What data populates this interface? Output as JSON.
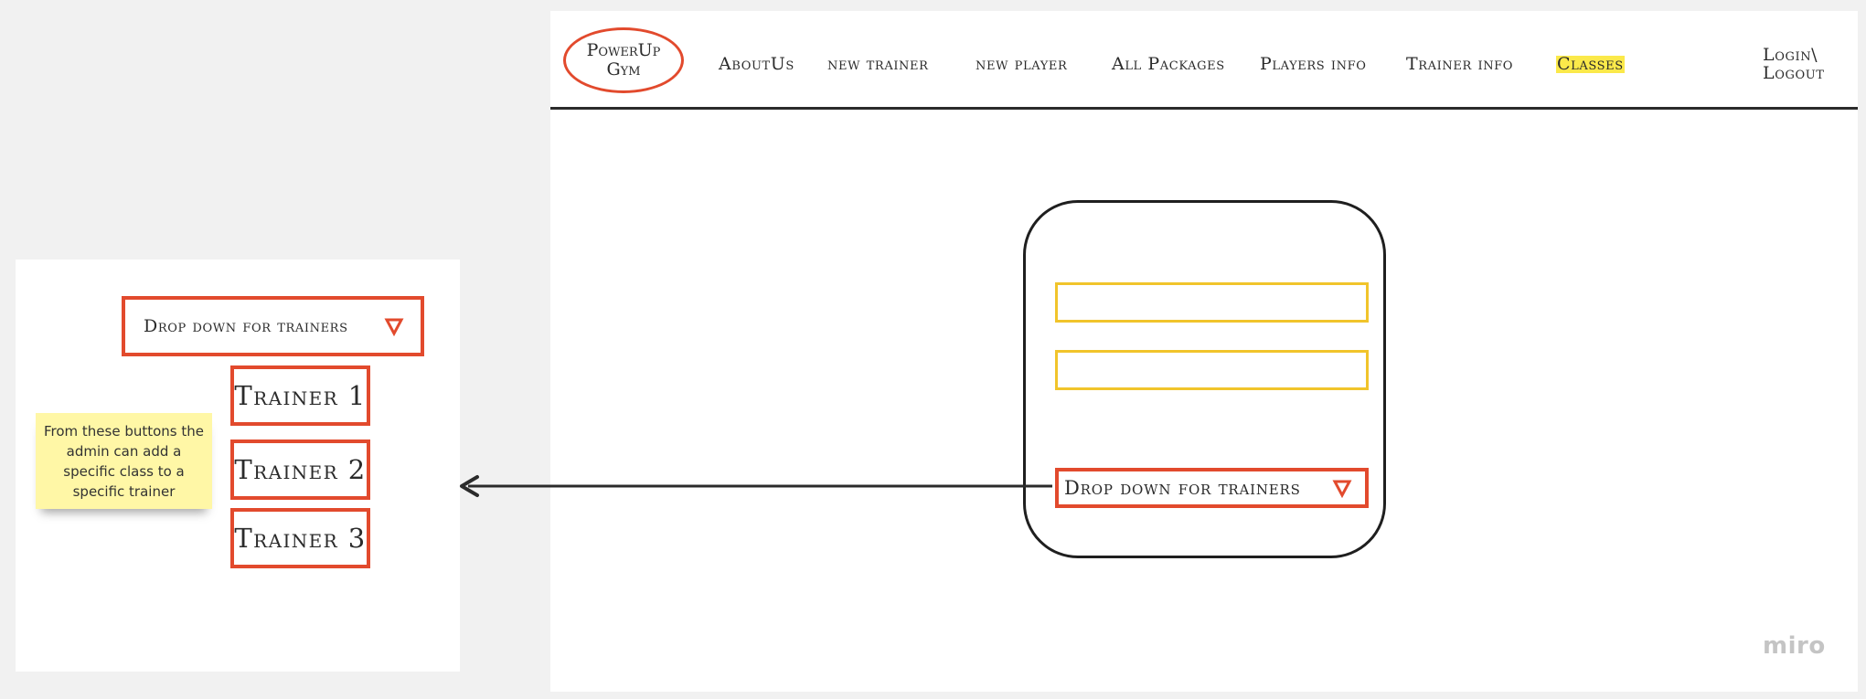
{
  "nav": {
    "logo_line1": "PowerUp",
    "logo_line2": "Gym",
    "items": [
      {
        "label": "AboutUs"
      },
      {
        "label": "new trainer"
      },
      {
        "label": "new player"
      },
      {
        "label": "All Packages"
      },
      {
        "label": "Players info"
      },
      {
        "label": "Trainer info"
      },
      {
        "label": "Classes",
        "highlighted": true
      }
    ],
    "login_line1": "Login\\",
    "login_line2": "Logout"
  },
  "form": {
    "dropdown_label": "Drop down for trainers"
  },
  "detail": {
    "dropdown_label": "Drop down for trainers",
    "trainers": [
      "Trainer 1",
      "Trainer 2",
      "Trainer 3"
    ],
    "note": "From these buttons the admin can add a specific class to a specific trainer"
  },
  "watermark": "miro",
  "colors": {
    "accent_red": "#e24a2d",
    "field_yellow": "#f1c42b",
    "highlight_yellow": "#fbe94a",
    "sticky_yellow": "#fff7a6"
  },
  "icons": {
    "dropdown_arrow": "triangle-down-icon",
    "connector": "arrow-left-icon"
  }
}
